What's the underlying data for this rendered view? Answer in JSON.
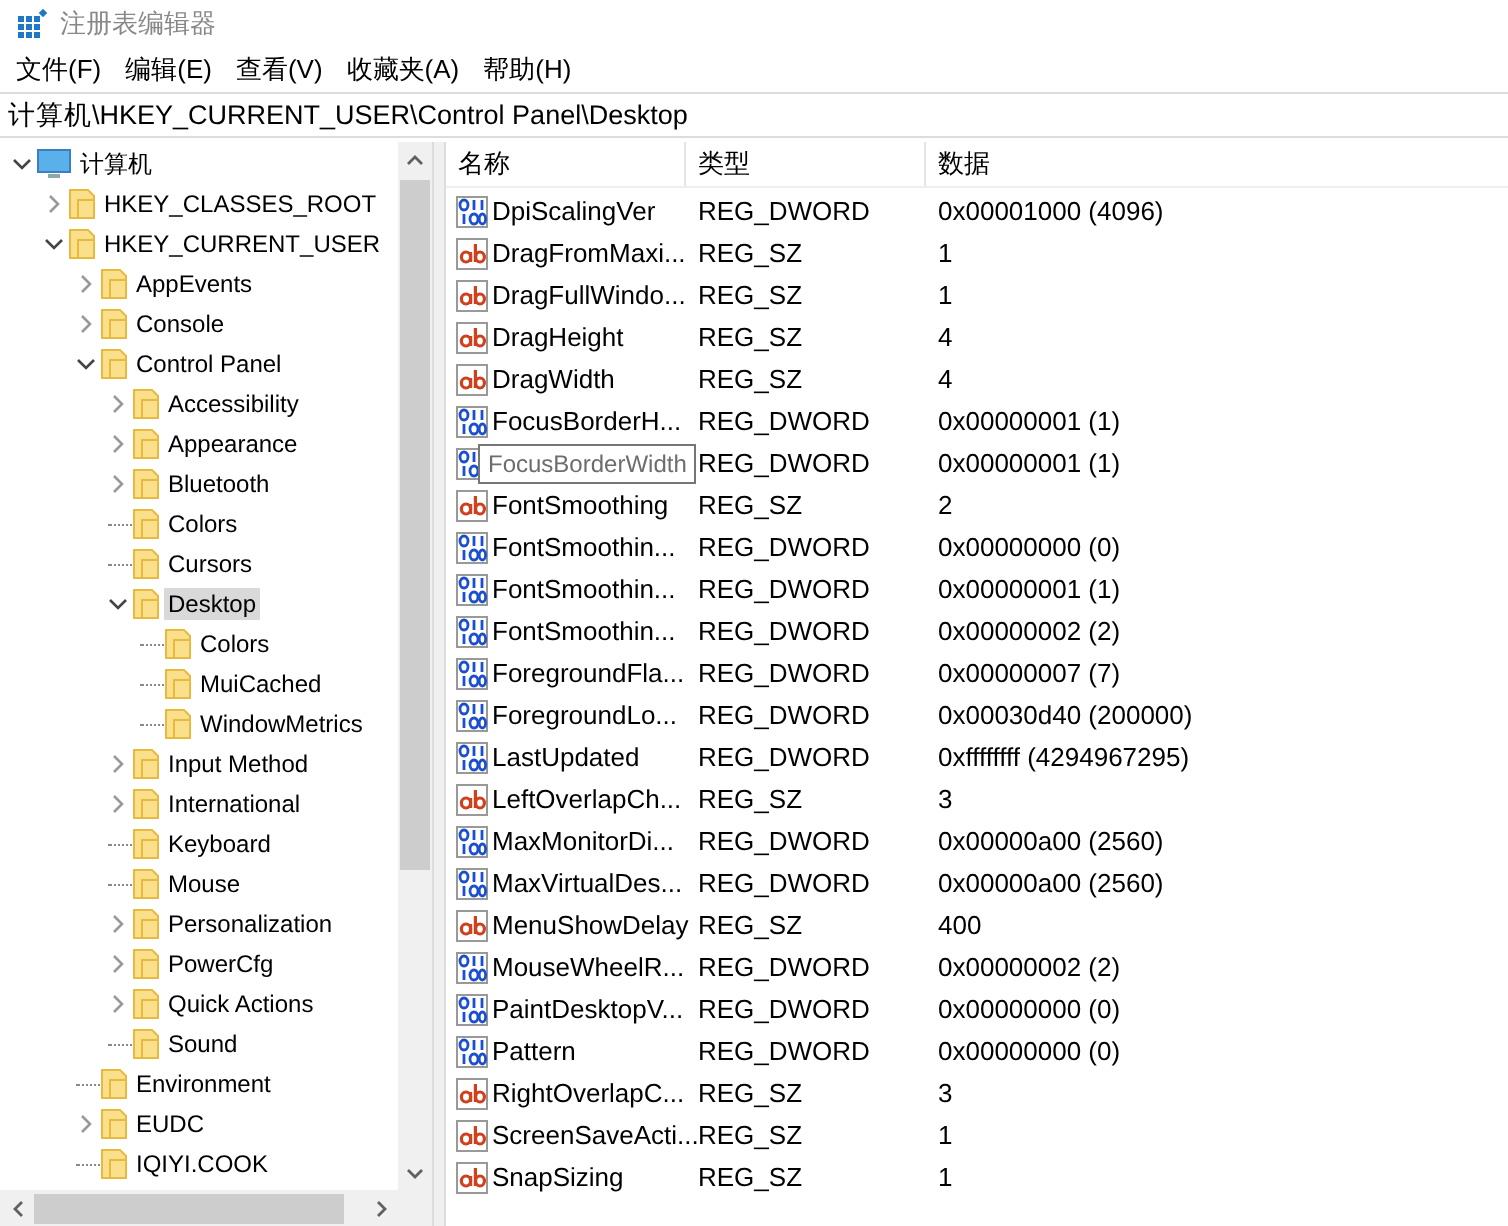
{
  "window": {
    "title": "注册表编辑器"
  },
  "menu": [
    "文件(F)",
    "编辑(E)",
    "查看(V)",
    "收藏夹(A)",
    "帮助(H)"
  ],
  "address": "计算机\\HKEY_CURRENT_USER\\Control Panel\\Desktop",
  "tree": [
    {
      "label": "计算机",
      "kind": "computer",
      "expanded": true,
      "selected": false,
      "children": [
        {
          "label": "HKEY_CLASSES_ROOT",
          "kind": "folder",
          "expanded": false,
          "selected": false
        },
        {
          "label": "HKEY_CURRENT_USER",
          "kind": "folder",
          "expanded": true,
          "selected": false,
          "children": [
            {
              "label": "AppEvents",
              "kind": "folder",
              "expanded": false,
              "selected": false
            },
            {
              "label": "Console",
              "kind": "folder",
              "expanded": false,
              "selected": false
            },
            {
              "label": "Control Panel",
              "kind": "folder",
              "expanded": true,
              "selected": false,
              "children": [
                {
                  "label": "Accessibility",
                  "kind": "folder",
                  "expanded": false,
                  "selected": false
                },
                {
                  "label": "Appearance",
                  "kind": "folder",
                  "expanded": false,
                  "selected": false
                },
                {
                  "label": "Bluetooth",
                  "kind": "folder",
                  "expanded": false,
                  "selected": false
                },
                {
                  "label": "Colors",
                  "kind": "folder",
                  "selected": false
                },
                {
                  "label": "Cursors",
                  "kind": "folder",
                  "selected": false
                },
                {
                  "label": "Desktop",
                  "kind": "folder",
                  "expanded": true,
                  "selected": true,
                  "children": [
                    {
                      "label": "Colors",
                      "kind": "folder",
                      "selected": false
                    },
                    {
                      "label": "MuiCached",
                      "kind": "folder",
                      "selected": false
                    },
                    {
                      "label": "WindowMetrics",
                      "kind": "folder",
                      "selected": false
                    }
                  ]
                },
                {
                  "label": "Input Method",
                  "kind": "folder",
                  "expanded": false,
                  "selected": false
                },
                {
                  "label": "International",
                  "kind": "folder",
                  "expanded": false,
                  "selected": false
                },
                {
                  "label": "Keyboard",
                  "kind": "folder",
                  "selected": false
                },
                {
                  "label": "Mouse",
                  "kind": "folder",
                  "selected": false
                },
                {
                  "label": "Personalization",
                  "kind": "folder",
                  "expanded": false,
                  "selected": false
                },
                {
                  "label": "PowerCfg",
                  "kind": "folder",
                  "expanded": false,
                  "selected": false
                },
                {
                  "label": "Quick Actions",
                  "kind": "folder",
                  "expanded": false,
                  "selected": false
                },
                {
                  "label": "Sound",
                  "kind": "folder",
                  "selected": false
                }
              ]
            },
            {
              "label": "Environment",
              "kind": "folder",
              "selected": false
            },
            {
              "label": "EUDC",
              "kind": "folder",
              "expanded": false,
              "selected": false
            },
            {
              "label": "IQIYI.COOK",
              "kind": "folder",
              "selected": false
            }
          ]
        }
      ]
    }
  ],
  "table": {
    "columns": [
      "名称",
      "类型",
      "数据"
    ],
    "rows": [
      {
        "kind": "dword",
        "name": "DpiScalingVer",
        "type": "REG_DWORD",
        "data": "0x00001000 (4096)"
      },
      {
        "kind": "string",
        "name": "DragFromMaxi...",
        "type": "REG_SZ",
        "data": "1"
      },
      {
        "kind": "string",
        "name": "DragFullWindo...",
        "type": "REG_SZ",
        "data": "1"
      },
      {
        "kind": "string",
        "name": "DragHeight",
        "type": "REG_SZ",
        "data": "4"
      },
      {
        "kind": "string",
        "name": "DragWidth",
        "type": "REG_SZ",
        "data": "4"
      },
      {
        "kind": "dword",
        "name": "FocusBorderH...",
        "type": "REG_DWORD",
        "data": "0x00000001 (1)"
      },
      {
        "kind": "dword",
        "tooltip": "FocusBorderWidth",
        "type": "REG_DWORD",
        "data": "0x00000001 (1)"
      },
      {
        "kind": "string",
        "name": "FontSmoothing",
        "type": "REG_SZ",
        "data": "2"
      },
      {
        "kind": "dword",
        "name": "FontSmoothin...",
        "type": "REG_DWORD",
        "data": "0x00000000 (0)"
      },
      {
        "kind": "dword",
        "name": "FontSmoothin...",
        "type": "REG_DWORD",
        "data": "0x00000001 (1)"
      },
      {
        "kind": "dword",
        "name": "FontSmoothin...",
        "type": "REG_DWORD",
        "data": "0x00000002 (2)"
      },
      {
        "kind": "dword",
        "name": "ForegroundFla...",
        "type": "REG_DWORD",
        "data": "0x00000007 (7)"
      },
      {
        "kind": "dword",
        "name": "ForegroundLo...",
        "type": "REG_DWORD",
        "data": "0x00030d40 (200000)"
      },
      {
        "kind": "dword",
        "name": "LastUpdated",
        "type": "REG_DWORD",
        "data": "0xffffffff (4294967295)"
      },
      {
        "kind": "string",
        "name": "LeftOverlapCh...",
        "type": "REG_SZ",
        "data": "3"
      },
      {
        "kind": "dword",
        "name": "MaxMonitorDi...",
        "type": "REG_DWORD",
        "data": "0x00000a00 (2560)"
      },
      {
        "kind": "dword",
        "name": "MaxVirtualDes...",
        "type": "REG_DWORD",
        "data": "0x00000a00 (2560)"
      },
      {
        "kind": "string",
        "name": "MenuShowDelay",
        "type": "REG_SZ",
        "data": "400"
      },
      {
        "kind": "dword",
        "name": "MouseWheelR...",
        "type": "REG_DWORD",
        "data": "0x00000002 (2)"
      },
      {
        "kind": "dword",
        "name": "PaintDesktopV...",
        "type": "REG_DWORD",
        "data": "0x00000000 (0)"
      },
      {
        "kind": "dword",
        "name": "Pattern",
        "type": "REG_DWORD",
        "data": "0x00000000 (0)"
      },
      {
        "kind": "string",
        "name": "RightOverlapC...",
        "type": "REG_SZ",
        "data": "3"
      },
      {
        "kind": "string",
        "name": "ScreenSaveActi...",
        "type": "REG_SZ",
        "data": "1"
      },
      {
        "kind": "string",
        "name": "SnapSizing",
        "type": "REG_SZ",
        "data": "1"
      }
    ]
  }
}
